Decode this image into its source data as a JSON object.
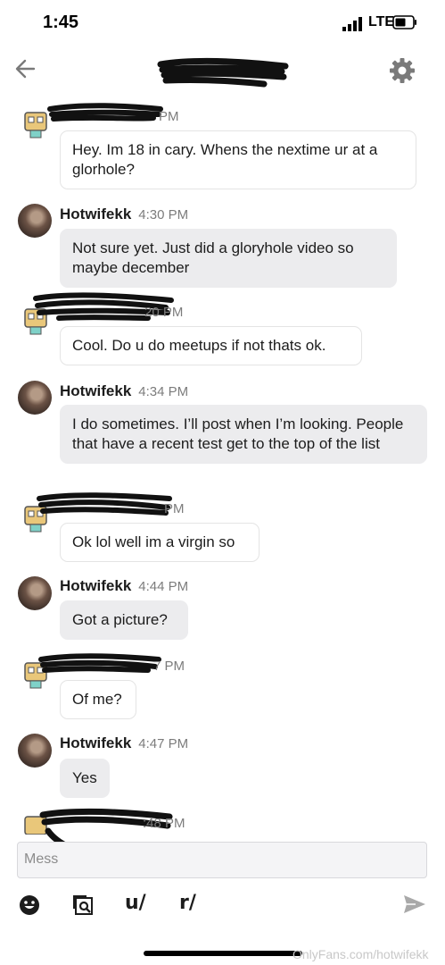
{
  "status": {
    "time": "1:45",
    "network": "LTE"
  },
  "icons": {
    "back": "arrow-left-icon",
    "settings": "gear-icon",
    "emoji": "emoji-icon",
    "image_search": "image-search-icon",
    "send": "send-icon"
  },
  "messages": [
    {
      "sender": "",
      "time": "PM",
      "text": "Hey. Im 18 in cary. Whens the nextime ur at a glorhole?"
    },
    {
      "sender": "Hotwifekk",
      "time": "4:30 PM",
      "text": "Not sure yet. Just did a gloryhole video so maybe december"
    },
    {
      "sender": "",
      "time": "20 PM",
      "text": "Cool. Do u do meetups if not thats ok."
    },
    {
      "sender": "Hotwifekk",
      "time": "4:34 PM",
      "text": "I do sometimes. I’ll post when I’m looking. People that have a recent test get to the top of the list"
    },
    {
      "sender": "",
      "time": "PM",
      "text": "Ok lol well im a virgin so"
    },
    {
      "sender": "Hotwifekk",
      "time": "4:44 PM",
      "text": "Got a picture?"
    },
    {
      "sender": "",
      "time": "7 PM",
      "text": "Of me?"
    },
    {
      "sender": "Hotwifekk",
      "time": "4:47 PM",
      "text": "Yes"
    },
    {
      "sender": "",
      "time": ":48 PM",
      "text": ""
    }
  ],
  "composer": {
    "placeholder": "Mess"
  },
  "toolbar": {
    "u_label": "u/",
    "r_label": "r/"
  },
  "watermark": "OnlyFans.com/hotwifekk"
}
